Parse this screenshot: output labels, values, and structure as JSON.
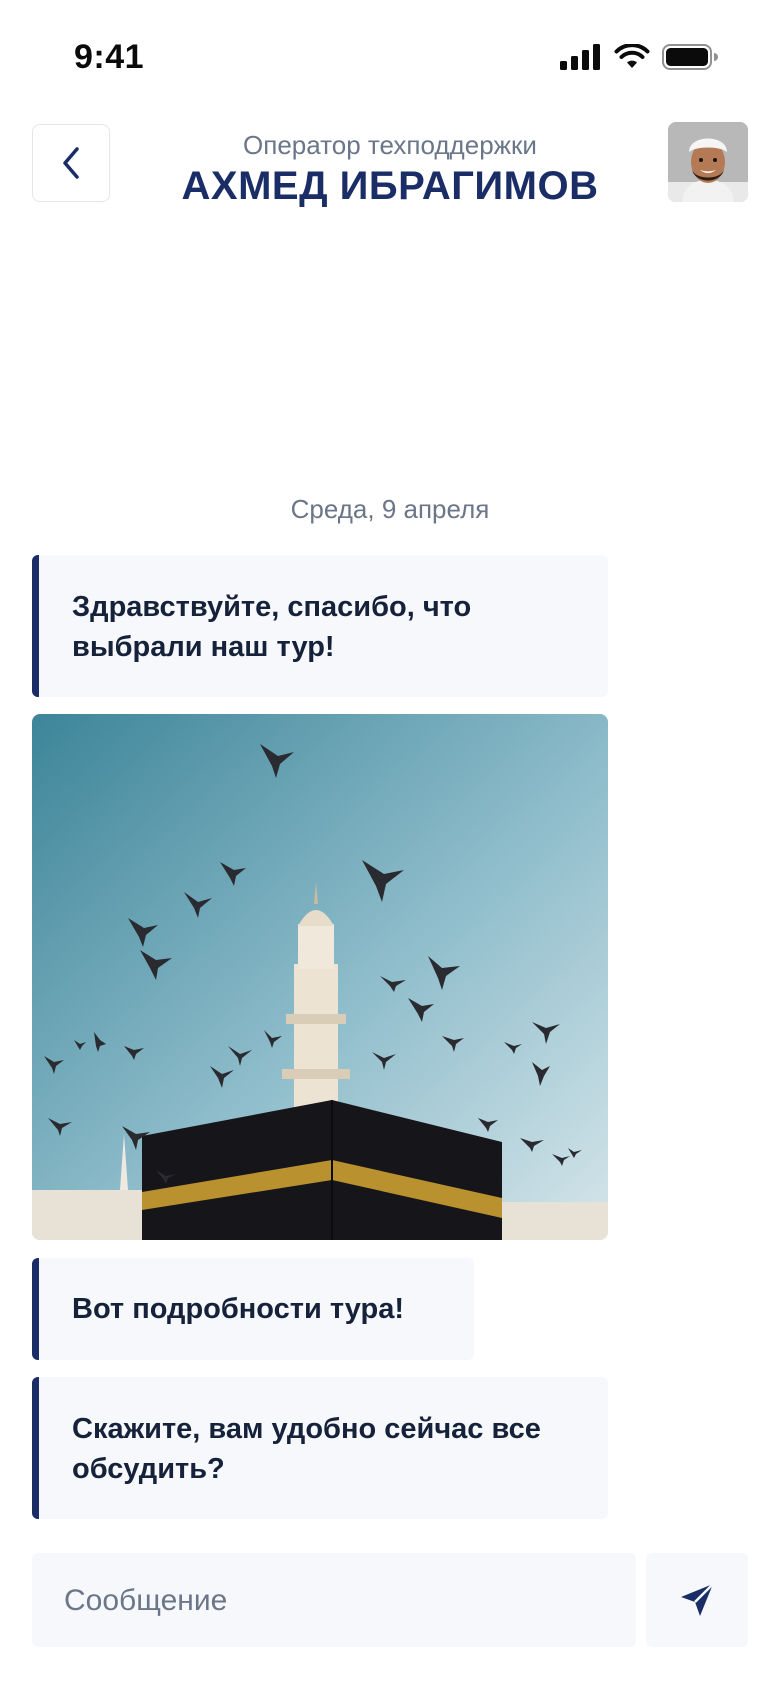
{
  "status_bar": {
    "time": "9:41"
  },
  "header": {
    "subtitle": "Оператор техподдержки",
    "title": "АХМЕД ИБРАГИМОВ"
  },
  "chat": {
    "date_label": "Среда, 9 апреля",
    "messages": [
      {
        "text": "Здравствуйте, спасибо, что выбрали наш тур!"
      },
      {
        "text": "Вот подробности тура!"
      },
      {
        "text": "Скажите, вам удобно сейчас все обсудить?"
      }
    ]
  },
  "composer": {
    "placeholder": "Сообщение"
  },
  "colors": {
    "accent": "#1a2d66",
    "bubble_bg": "#f6f8fb",
    "muted_text": "#6b7689"
  }
}
